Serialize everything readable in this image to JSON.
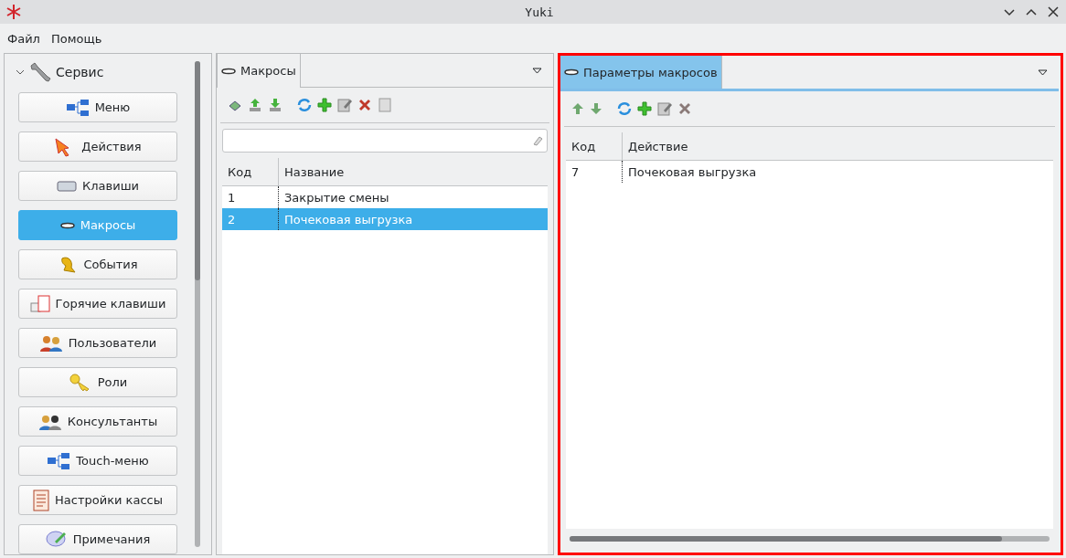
{
  "window": {
    "title": "Yuki"
  },
  "menu": [
    "Файл",
    "Помощь"
  ],
  "sidebar": {
    "group": {
      "label": "Сервис",
      "expanded": true
    },
    "items": [
      {
        "label": "Меню",
        "selected": false
      },
      {
        "label": "Действия",
        "selected": false
      },
      {
        "label": "Клавиши",
        "selected": false
      },
      {
        "label": "Макросы",
        "selected": true
      },
      {
        "label": "События",
        "selected": false
      },
      {
        "label": "Горячие клавиши",
        "selected": false
      },
      {
        "label": "Пользователи",
        "selected": false
      },
      {
        "label": "Роли",
        "selected": false
      },
      {
        "label": "Консультанты",
        "selected": false
      },
      {
        "label": "Touch-меню",
        "selected": false
      },
      {
        "label": "Настройки кассы",
        "selected": false
      },
      {
        "label": "Примечания",
        "selected": false
      }
    ]
  },
  "macros_panel": {
    "tab": {
      "label": "Макросы",
      "selected": false
    },
    "columns": [
      "Код",
      "Название"
    ],
    "rows": [
      {
        "cells": [
          "1",
          "Закрытие смены"
        ],
        "selected": false
      },
      {
        "cells": [
          "2",
          "Почековая выгрузка"
        ],
        "selected": true
      }
    ]
  },
  "params_panel": {
    "highlighted": true,
    "tab": {
      "label": "Параметры макросов",
      "selected": true
    },
    "columns": [
      "Код",
      "Действие"
    ],
    "rows": [
      {
        "cells": [
          "7",
          "Почековая выгрузка"
        ],
        "selected": false
      }
    ]
  }
}
